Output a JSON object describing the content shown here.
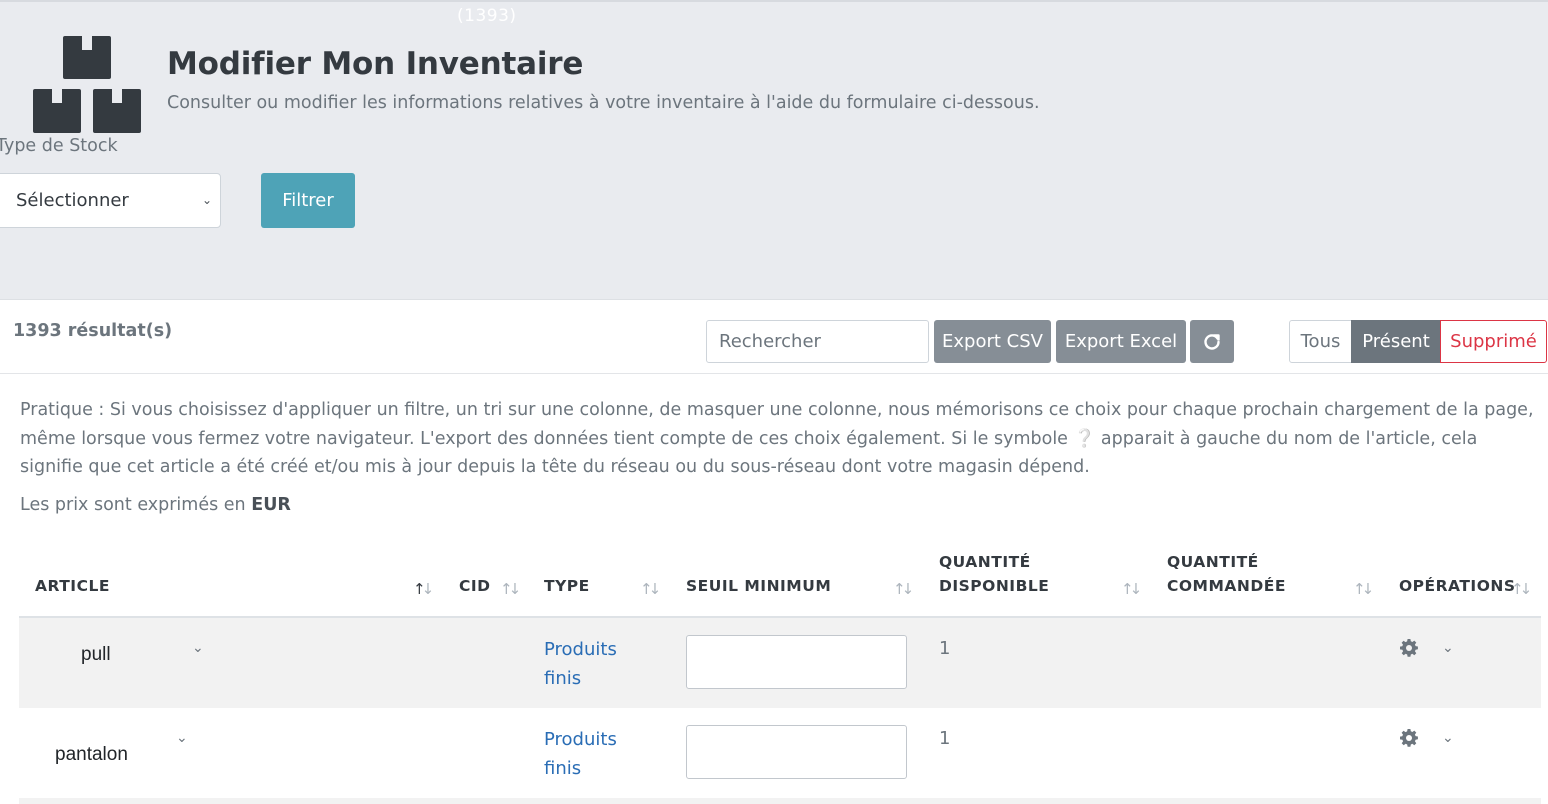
{
  "header": {
    "top_count": "(1393)",
    "title": "Modifier Mon Inventaire",
    "subtitle": "Consulter ou modifier les informations relatives à votre inventaire à l'aide du formulaire ci-dessous.",
    "icon": "boxes-icon"
  },
  "filter": {
    "label": "Type de Stock",
    "select_value": "Sélectionner",
    "button_label": "Filtrer"
  },
  "toolbar": {
    "results_count": "1393 résultat(s)",
    "search_placeholder": "Rechercher",
    "export_csv": "Export CSV",
    "export_excel": "Export Excel",
    "refresh_icon": "refresh-icon",
    "seg_all": "Tous",
    "seg_present": "Présent",
    "seg_deleted": "Supprimé"
  },
  "info": {
    "text_before": "Pratique : Si vous choisissez d'appliquer un filtre, un tri sur une colonne, de masquer une colonne, nous mémorisons ce choix pour chaque prochain chargement de la page, même lorsque vous fermez votre navigateur. L'export des données tient compte de ces choix également.  Si le symbole",
    "text_after": "apparait à gauche du nom de l'article, cela signifie que cet article a été créé et/ou mis à jour depuis la tête du réseau ou du sous-réseau dont votre magasin dépend.",
    "price_prefix": "Les prix sont exprimés en",
    "currency": "EUR"
  },
  "table": {
    "columns": {
      "article": "ARTICLE",
      "cid": "CID",
      "type": "TYPE",
      "seuil": "SEUIL MINIMUM",
      "qty_available_1": "QUANTITÉ",
      "qty_available_2": "DISPONIBLE",
      "qty_ordered_1": "QUANTITÉ",
      "qty_ordered_2": "COMMANDÉE",
      "operations": "OPÉRATIONS"
    },
    "rows": [
      {
        "article": "pull",
        "type_1": "Produits",
        "type_2": "finis",
        "seuil_value": "",
        "qty_available": "1",
        "qty_ordered": ""
      },
      {
        "article": "pantalon",
        "type_1": "Produits",
        "type_2": "finis",
        "seuil_value": "",
        "qty_available": "1",
        "qty_ordered": ""
      }
    ]
  },
  "colors": {
    "accent": "#4ea3b7",
    "link": "#2a6db5",
    "danger": "#dc3545",
    "button_grey": "#868e96",
    "panel_bg": "#e9ebef"
  }
}
